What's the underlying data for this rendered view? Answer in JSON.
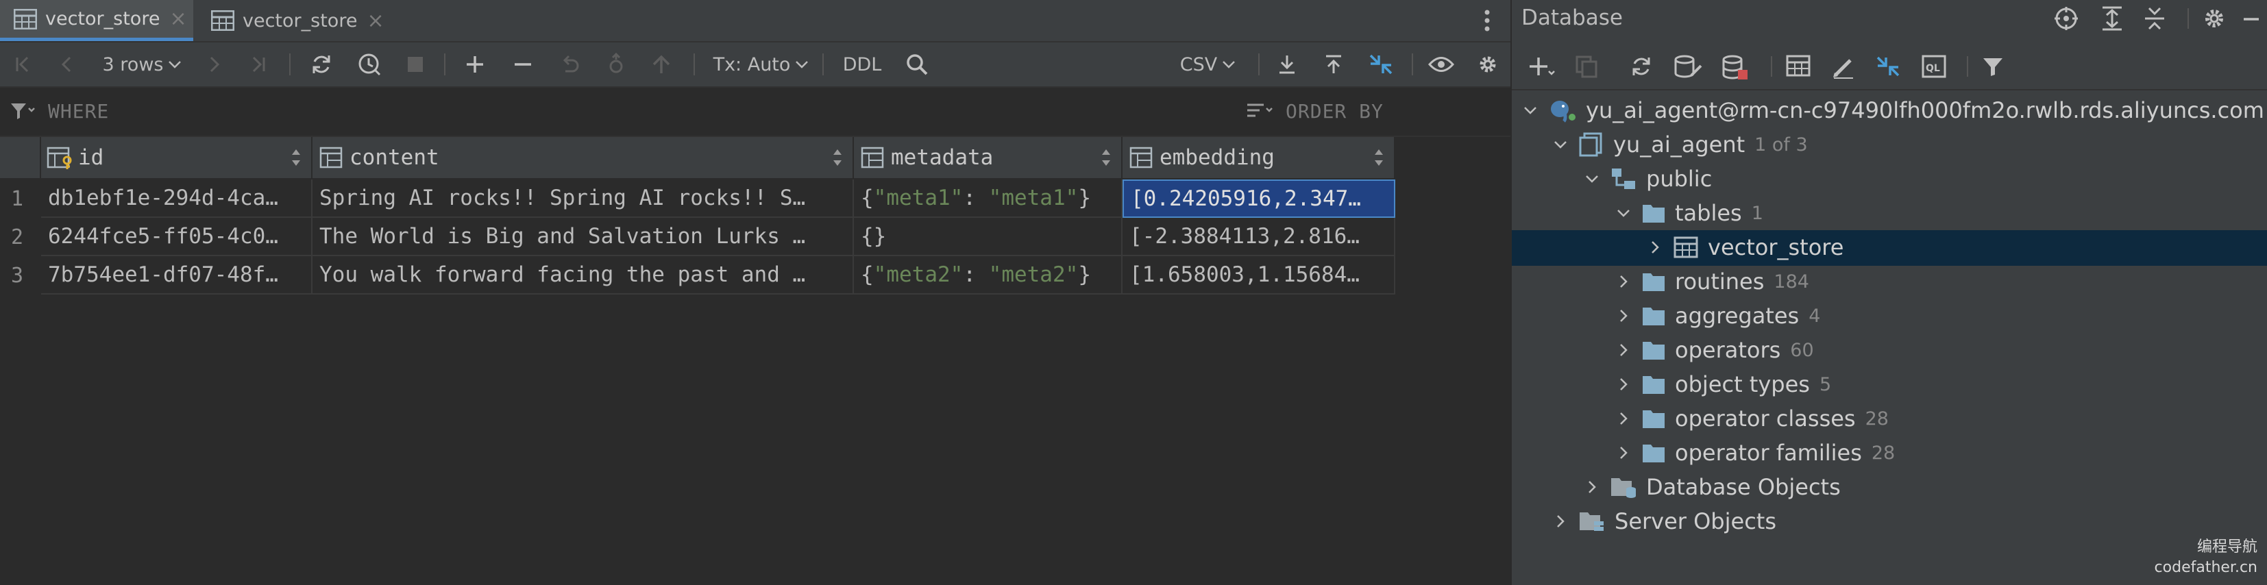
{
  "tabs": [
    {
      "label": "vector_store",
      "active": true
    },
    {
      "label": "vector_store",
      "active": false
    }
  ],
  "toolbar": {
    "rows_label": "3 rows",
    "tx_label": "Tx: Auto",
    "ddl_label": "DDL",
    "export_format": "CSV"
  },
  "filter": {
    "where_label": "WHERE",
    "order_by_label": "ORDER BY"
  },
  "table": {
    "columns": [
      "id",
      "content",
      "metadata",
      "embedding"
    ],
    "row_numbers": [
      "1",
      "2",
      "3"
    ],
    "rows": [
      {
        "id": "db1ebf1e-294d-4ca…",
        "content": "Spring AI rocks!! Spring AI rocks!! S…",
        "metadata_key": "\"meta1\"",
        "metadata_value": "\"meta1\"",
        "embedding": "[0.24205916,2.347…"
      },
      {
        "id": "6244fce5-ff05-4c0…",
        "content": "The World is Big and Salvation Lurks …",
        "metadata_raw": "{}",
        "embedding": "[-2.3884113,2.816…"
      },
      {
        "id": "7b754ee1-df07-48f…",
        "content": "You walk forward facing the past and …",
        "metadata_key": "\"meta2\"",
        "metadata_value": "\"meta2\"",
        "embedding": "[1.658003,1.15684…"
      }
    ]
  },
  "database_panel": {
    "title": "Database",
    "tree": {
      "connection": "yu_ai_agent@rm-cn-c97490lfh000fm2o.rwlb.rds.aliyuncs.com",
      "database": "yu_ai_agent",
      "database_badge": "1 of 3",
      "schema": "public",
      "tables_label": "tables",
      "tables_count": "1",
      "table_item": "vector_store",
      "folders": [
        {
          "label": "routines",
          "count": "184"
        },
        {
          "label": "aggregates",
          "count": "4"
        },
        {
          "label": "operators",
          "count": "60"
        },
        {
          "label": "object types",
          "count": "5"
        },
        {
          "label": "operator classes",
          "count": "28"
        },
        {
          "label": "operator families",
          "count": "28"
        }
      ],
      "database_objects": "Database Objects",
      "server_objects": "Server Objects"
    }
  },
  "watermark": {
    "line1": "编程导航",
    "line2": "codefather.cn"
  },
  "colors": {
    "accent": "#4a88c7",
    "selection": "#214283",
    "tree_selection": "#0d293e",
    "json_string": "#6a8759",
    "folder": "#87afc8"
  }
}
